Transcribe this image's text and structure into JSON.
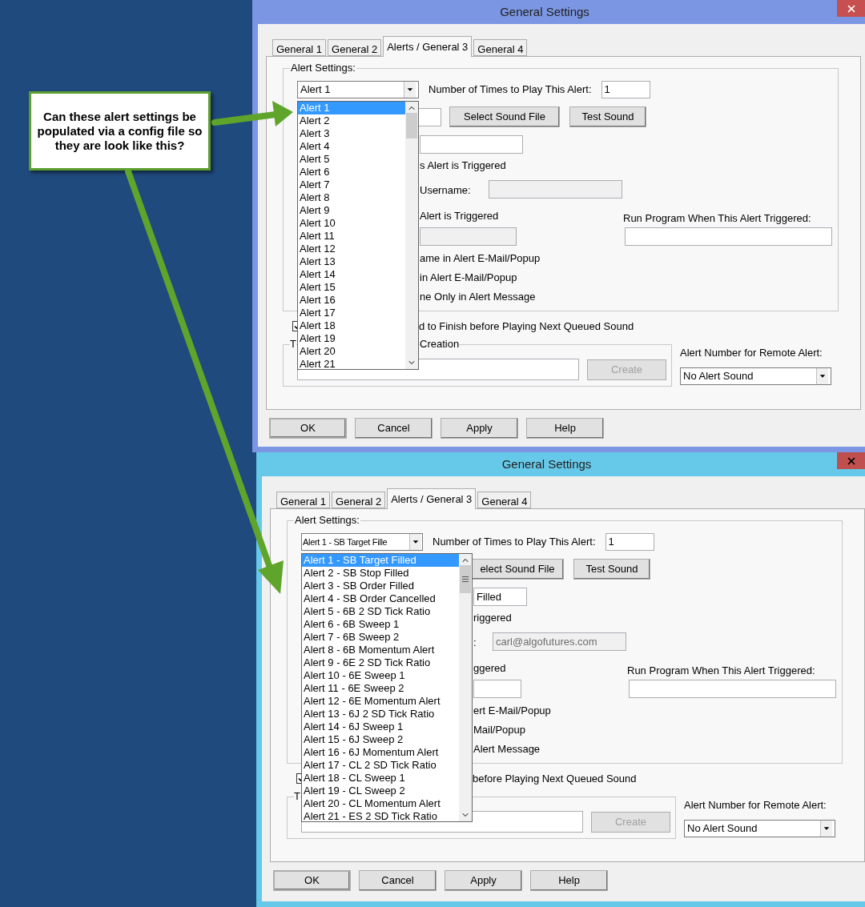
{
  "callout": "Can these alert settings be populated via a config file so they are look like this?",
  "dialogs": [
    {
      "title": "General Settings",
      "tabs": [
        {
          "label": "General 1",
          "selected": false
        },
        {
          "label": "General 2",
          "selected": false
        },
        {
          "label": "Alerts / General 3",
          "selected": true
        },
        {
          "label": "General 4",
          "selected": false
        }
      ],
      "group_label": "Alert Settings:",
      "alert_combo": "Alert 1",
      "play_count_label": "Number of Times to Play This Alert:",
      "play_count": "1",
      "sound_file_field": {
        "disabled": false
      },
      "select_sound_button": "Select Sound File",
      "test_sound_button": "Test Sound",
      "row3_field": {
        "disabled": false
      },
      "row4_text": "s Alert is Triggered",
      "username_label": "Username:",
      "user_field": {
        "disabled": true
      },
      "row6_text": "Alert is Triggered",
      "run_program_label": "Run Program When This Alert Triggered:",
      "row7_field": {
        "disabled": true
      },
      "row8_text": "ame in Alert E-Mail/Popup",
      "row9_text": "in Alert E-Mail/Popup",
      "row10_text": "ne Only in Alert Message",
      "queue_checkbox": {
        "checked": true
      },
      "queue_text": "d to Finish before Playing Next Queued Sound",
      "phrase_group_label": [
        "T",
        "Creation"
      ],
      "create_button": {
        "label": "Create",
        "disabled": true
      },
      "remote_alert_label": "Alert Number for Remote Alert:",
      "remote_alert_combo": "No Alert Sound",
      "buttons": [
        "OK",
        "Cancel",
        "Apply",
        "Help"
      ],
      "alert_list": [
        {
          "label": "Alert 1",
          "selected": true
        },
        {
          "label": "Alert 2",
          "selected": false
        },
        {
          "label": "Alert 3",
          "selected": false
        },
        {
          "label": "Alert 4",
          "selected": false
        },
        {
          "label": "Alert 5",
          "selected": false
        },
        {
          "label": "Alert 6",
          "selected": false
        },
        {
          "label": "Alert 7",
          "selected": false
        },
        {
          "label": "Alert 8",
          "selected": false
        },
        {
          "label": "Alert 9",
          "selected": false
        },
        {
          "label": "Alert 10",
          "selected": false
        },
        {
          "label": "Alert 11",
          "selected": false
        },
        {
          "label": "Alert 12",
          "selected": false
        },
        {
          "label": "Alert 13",
          "selected": false
        },
        {
          "label": "Alert 14",
          "selected": false
        },
        {
          "label": "Alert 15",
          "selected": false
        },
        {
          "label": "Alert 16",
          "selected": false
        },
        {
          "label": "Alert 17",
          "selected": false
        },
        {
          "label": "Alert 18",
          "selected": false
        },
        {
          "label": "Alert 19",
          "selected": false
        },
        {
          "label": "Alert 20",
          "selected": false
        },
        {
          "label": "Alert 21",
          "selected": false
        }
      ]
    },
    {
      "title": "General Settings",
      "tabs": [
        {
          "label": "General 1",
          "selected": false
        },
        {
          "label": "General 2",
          "selected": false
        },
        {
          "label": "Alerts / General 3",
          "selected": true
        },
        {
          "label": "General 4",
          "selected": false
        }
      ],
      "group_label": "Alert Settings:",
      "alert_combo": "Alert 1 - SB Target Fille",
      "play_count_label": "Number of Times to Play This Alert:",
      "play_count": "1",
      "select_sound_button": "elect Sound File",
      "test_sound_button": "Test Sound",
      "row3_field": {
        "disabled": false,
        "value": "Filled"
      },
      "row4_text": "riggered",
      "username_label": ":",
      "user_field": {
        "disabled": true,
        "value": "carl@algofutures.com"
      },
      "row6_text": "ggered",
      "run_program_label": "Run Program When This Alert Triggered:",
      "row7_field": {
        "disabled": false
      },
      "row8_text": "ert E-Mail/Popup",
      "row9_text": "Mail/Popup",
      "row10_text": "Alert Message",
      "queue_checkbox": {
        "checked": true
      },
      "queue_text": "before Playing Next Queued Sound",
      "phrase_group_label": [
        "T"
      ],
      "create_button": {
        "label": "Create",
        "disabled": true
      },
      "remote_alert_label": "Alert Number for Remote Alert:",
      "remote_alert_combo": "No Alert Sound",
      "buttons": [
        "OK",
        "Cancel",
        "Apply",
        "Help"
      ],
      "alert_list": [
        {
          "label": "Alert 1 - SB Target Filled",
          "selected": true
        },
        {
          "label": "Alert 2 - SB Stop Filled",
          "selected": false
        },
        {
          "label": "Alert 3 - SB Order Filled",
          "selected": false
        },
        {
          "label": "Alert 4 - SB Order Cancelled",
          "selected": false
        },
        {
          "label": "Alert 5 - 6B  2 SD Tick Ratio",
          "selected": false
        },
        {
          "label": "Alert 6 - 6B Sweep 1",
          "selected": false
        },
        {
          "label": "Alert 7 - 6B Sweep 2",
          "selected": false
        },
        {
          "label": "Alert 8 - 6B Momentum Alert",
          "selected": false
        },
        {
          "label": "Alert 9 - 6E  2 SD Tick Ratio",
          "selected": false
        },
        {
          "label": "Alert 10 - 6E Sweep 1",
          "selected": false
        },
        {
          "label": "Alert 11 - 6E Sweep 2",
          "selected": false
        },
        {
          "label": "Alert 12 - 6E Momentum Alert",
          "selected": false
        },
        {
          "label": "Alert 13 - 6J 2 SD Tick Ratio",
          "selected": false
        },
        {
          "label": "Alert 14 - 6J Sweep 1",
          "selected": false
        },
        {
          "label": "Alert 15 - 6J Sweep 2",
          "selected": false
        },
        {
          "label": "Alert 16 - 6J Momentum Alert",
          "selected": false
        },
        {
          "label": "Alert 17 - CL 2 SD Tick Ratio",
          "selected": false
        },
        {
          "label": "Alert 18 - CL Sweep 1",
          "selected": false
        },
        {
          "label": "Alert 19 - CL Sweep 2",
          "selected": false
        },
        {
          "label": "Alert 20 - CL Momentum Alert",
          "selected": false
        },
        {
          "label": "Alert 21 - ES 2 SD Tick Ratio",
          "selected": false
        }
      ]
    }
  ]
}
